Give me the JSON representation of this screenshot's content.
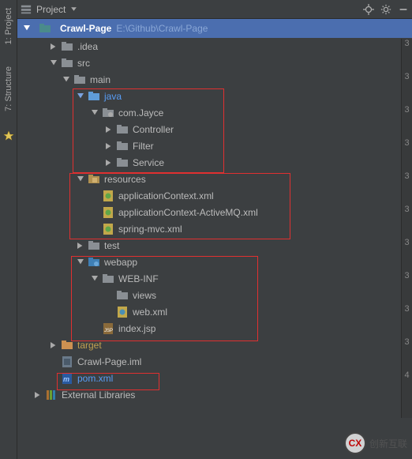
{
  "rail": {
    "project_tab": "1: Project",
    "structure_tab": "7: Structure"
  },
  "toolbar": {
    "title": "Project"
  },
  "breadcrumb": {
    "name": "Crawl-Page",
    "path": "E:\\Github\\Crawl-Page"
  },
  "tree": {
    "idea": ".idea",
    "src": "src",
    "main": "main",
    "java": "java",
    "comjayce": "com.Jayce",
    "controller": "Controller",
    "filter": "Filter",
    "service": "Service",
    "resources": "resources",
    "appctx": "applicationContext.xml",
    "appctxmq": "applicationContext-ActiveMQ.xml",
    "springmvc": "spring-mvc.xml",
    "test": "test",
    "webapp": "webapp",
    "webinf": "WEB-INF",
    "views": "views",
    "webxml": "web.xml",
    "indexjsp": "index.jsp",
    "target": "target",
    "iml": "Crawl-Page.iml",
    "pom": "pom.xml",
    "extlib": "External Libraries"
  },
  "edge": [
    "3",
    "3",
    "3",
    "3",
    "3",
    "3",
    "3",
    "3",
    "3",
    "3",
    "4"
  ],
  "watermark": {
    "text": "创新互联",
    "logo": "CX"
  }
}
